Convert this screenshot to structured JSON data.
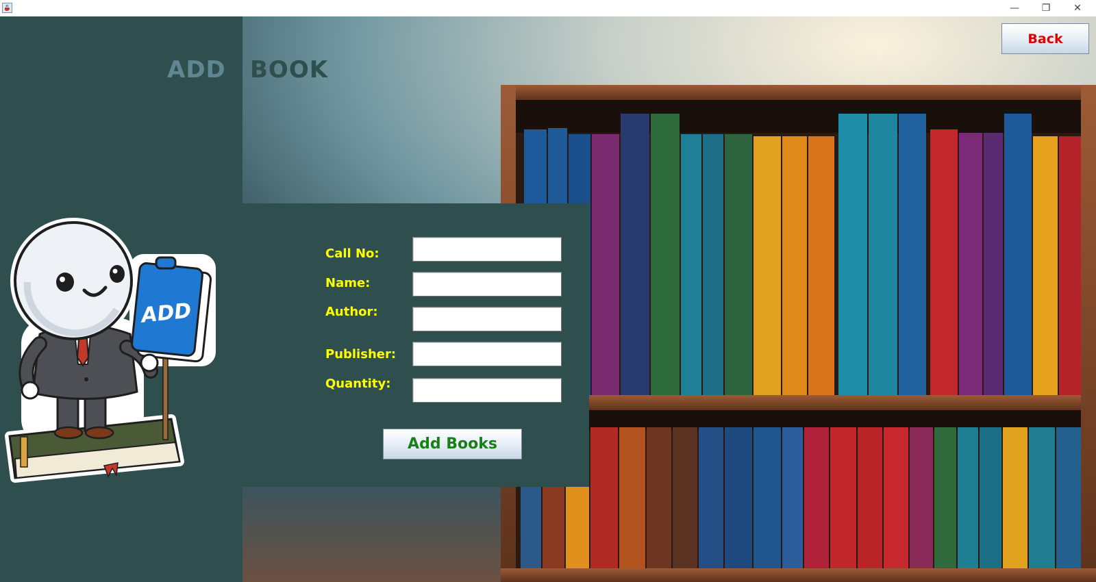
{
  "window": {
    "app_icon": "java-cup-icon",
    "controls": [
      "minimize-icon",
      "restore-icon",
      "close-icon"
    ],
    "symbols": {
      "minimize": "—",
      "restore": "❐",
      "close": "✕"
    }
  },
  "header": {
    "title_word_1": "ADD",
    "title_word_2": "BOOK"
  },
  "form": {
    "fields": [
      {
        "label": "Call No:",
        "value": ""
      },
      {
        "label": "Name:",
        "value": ""
      },
      {
        "label": "Author:",
        "value": ""
      },
      {
        "label": "Publisher:",
        "value": ""
      },
      {
        "label": "Quantity:",
        "value": ""
      }
    ],
    "submit_label": "Add Books"
  },
  "nav": {
    "back_label": "Back"
  },
  "illustration": {
    "book_text": "ADD",
    "subject": "mascot-holding-book",
    "background": "bookshelf-photo"
  },
  "colors": {
    "panel": "#2f4f4f",
    "label": "#ffff00",
    "title": "#5f8691",
    "add_button_text": "#198019",
    "back_button_text": "#e00000"
  }
}
